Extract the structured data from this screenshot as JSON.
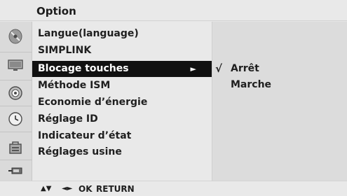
{
  "title": "Option",
  "menu": {
    "items": [
      {
        "label": "Langue(language)"
      },
      {
        "label": "SIMPLINK"
      },
      {
        "label": "Blocage touches",
        "arrow": "►"
      },
      {
        "label": "Méthode ISM"
      },
      {
        "label": "Economie d’énergie"
      },
      {
        "label": "Réglage ID"
      },
      {
        "label": "Indicateur d’état"
      },
      {
        "label": "Réglages usine"
      }
    ],
    "selected_index": 2
  },
  "submenu": {
    "options": [
      {
        "label": "Arrêt",
        "checked": true,
        "check_glyph": "√"
      },
      {
        "label": "Marche",
        "checked": false
      }
    ]
  },
  "footer": {
    "nav_updown": "▲▼",
    "nav_leftright": "◄►",
    "ok_label": "OK",
    "return_label": "RETURN"
  },
  "icons": [
    "satellite-dish-icon",
    "tv-screen-icon",
    "speaker-icon",
    "clock-icon",
    "lock-icon",
    "connector-icon"
  ]
}
